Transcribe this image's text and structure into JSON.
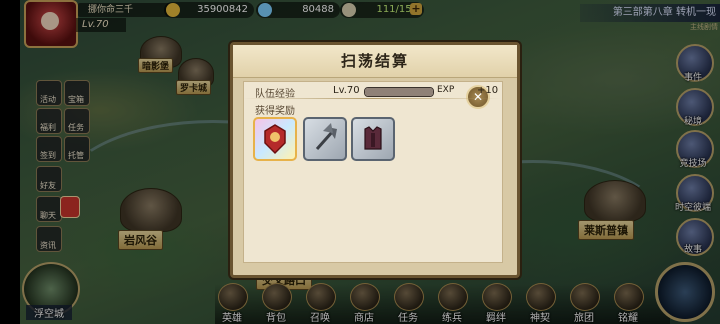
{
  "player": {
    "name": "挪你命三千",
    "level": "Lv.70"
  },
  "resources": [
    {
      "icon": "gold-coin-icon",
      "value": "35900842",
      "color": "#e6b93c"
    },
    {
      "icon": "diamond-icon",
      "value": "80488",
      "color": "#7fd0ff"
    },
    {
      "icon": "stamina-scroll-icon",
      "value": "111/150",
      "color": "#d9d0b0"
    }
  ],
  "chapter": {
    "title": "第三部第八章 转机一现",
    "subtitle": "主线剧情"
  },
  "left_buttons": [
    {
      "label": "活动"
    },
    {
      "label": "宝箱"
    },
    {
      "label": "福利"
    },
    {
      "label": "任务"
    },
    {
      "label": "签到"
    },
    {
      "label": "托管"
    },
    {
      "label": "好友"
    },
    {
      "label": "聊天"
    },
    {
      "label": "资讯"
    }
  ],
  "right_buttons": [
    {
      "label": "事件"
    },
    {
      "label": "秘境"
    },
    {
      "label": "竞技场"
    },
    {
      "label": "时空彼端"
    },
    {
      "label": "故事"
    }
  ],
  "locations": {
    "top_left": "暗影堡",
    "mountain": "罗卡城",
    "left": "岩风谷",
    "right": "莱斯普镇",
    "bottom": "交叉路口"
  },
  "modal": {
    "title": "扫荡结算",
    "team_exp_label": "队伍经验",
    "level": "Lv.70",
    "exp_unit": "EXP",
    "exp_gain": "+10",
    "exp_progress": 1.0,
    "rewards_label": "获得奖励",
    "close_symbol": "✕"
  },
  "bottom_nav": [
    {
      "label": "英雄"
    },
    {
      "label": "背包"
    },
    {
      "label": "召唤"
    },
    {
      "label": "商店"
    },
    {
      "label": "任务"
    },
    {
      "label": "练兵"
    },
    {
      "label": "羁绊"
    },
    {
      "label": "神契"
    },
    {
      "label": "旅团"
    },
    {
      "label": "铭耀"
    }
  ],
  "home": {
    "label": "浮空城"
  }
}
